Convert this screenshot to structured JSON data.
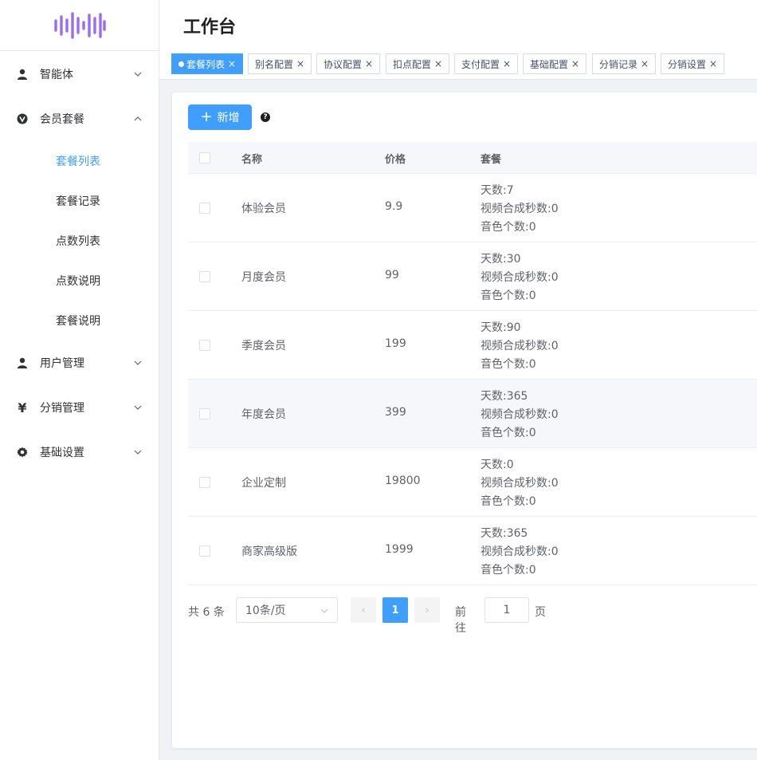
{
  "logo": {
    "icon": "sound-wave-logo",
    "color": "#9b6bf0"
  },
  "sidebar": {
    "items": [
      {
        "label": "智能体",
        "icon": "user-icon",
        "expanded": false
      },
      {
        "label": "会员套餐",
        "icon": "vip-badge-icon",
        "expanded": true,
        "children": [
          "套餐列表",
          "套餐记录",
          "点数列表",
          "点数说明",
          "套餐说明"
        ],
        "active": "套餐列表"
      },
      {
        "label": "用户管理",
        "icon": "user-icon",
        "expanded": false
      },
      {
        "label": "分销管理",
        "icon": "yen-icon",
        "expanded": false
      },
      {
        "label": "基础设置",
        "icon": "gear-icon",
        "expanded": false
      }
    ]
  },
  "header": {
    "title": "工作台"
  },
  "tabs": [
    "套餐列表",
    "别名配置",
    "协议配置",
    "扣点配置",
    "支付配置",
    "基础配置",
    "分销记录",
    "分销设置"
  ],
  "active_tab": "套餐列表",
  "toolbar": {
    "add_label": "新增",
    "help": "?"
  },
  "table": {
    "columns": [
      "名称",
      "价格",
      "套餐"
    ],
    "rows": [
      {
        "name": "体验会员",
        "price": "9.9",
        "days": "天数:7",
        "video": "视频合成秒数:0",
        "voice": "音色个数:0"
      },
      {
        "name": "月度会员",
        "price": "99",
        "days": "天数:30",
        "video": "视频合成秒数:0",
        "voice": "音色个数:0"
      },
      {
        "name": "季度会员",
        "price": "199",
        "days": "天数:90",
        "video": "视频合成秒数:0",
        "voice": "音色个数:0"
      },
      {
        "name": "年度会员",
        "price": "399",
        "days": "天数:365",
        "video": "视频合成秒数:0",
        "voice": "音色个数:0"
      },
      {
        "name": "企业定制",
        "price": "19800",
        "days": "天数:0",
        "video": "视频合成秒数:0",
        "voice": "音色个数:0"
      },
      {
        "name": "商家高级版",
        "price": "1999",
        "days": "天数:365",
        "video": "视频合成秒数:0",
        "voice": "音色个数:0"
      }
    ]
  },
  "pagination": {
    "total": "共 6 条",
    "page_size": "10条/页",
    "current": "1",
    "goto_label": "前往",
    "goto_value": "1",
    "page_suffix": "页"
  },
  "colors": {
    "primary": "#409eff",
    "active_menu": "#409eff"
  }
}
